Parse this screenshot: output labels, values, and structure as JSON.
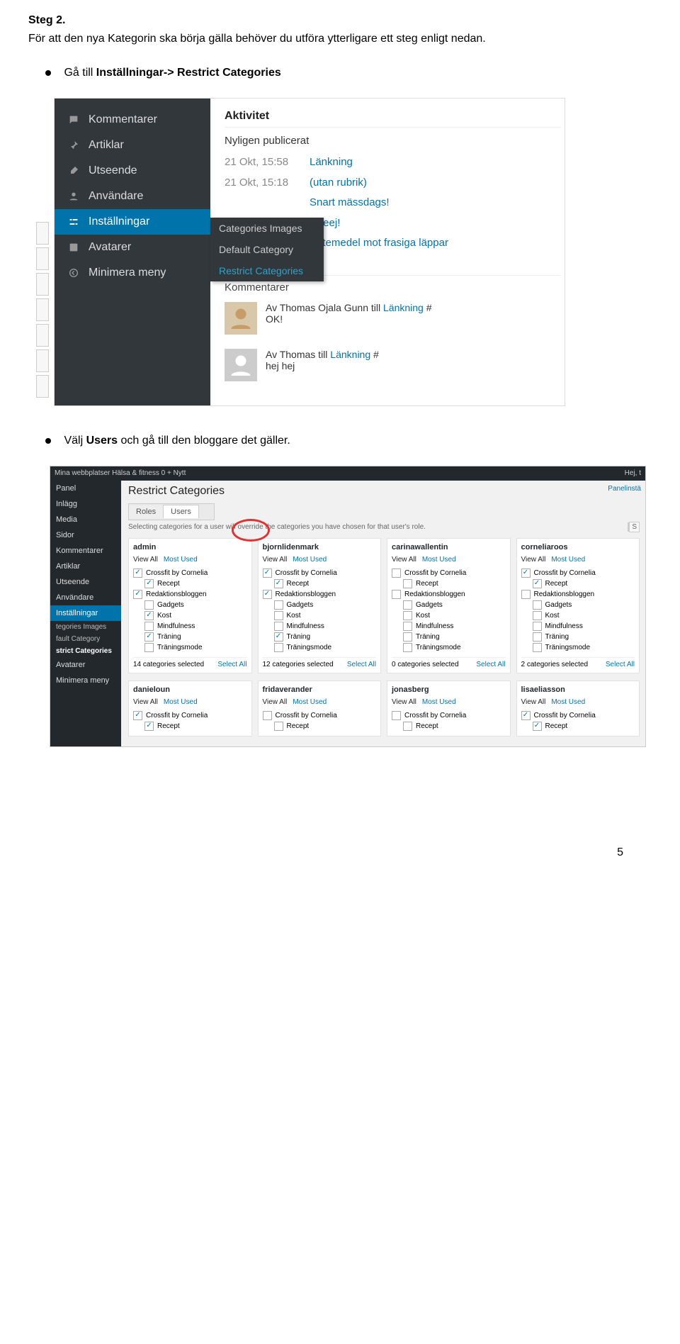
{
  "doc": {
    "step_title": "Steg 2.",
    "intro": "För att den nya Kategorin ska börja gälla behöver du utföra ytterligare ett steg enligt nedan.",
    "bullet1_pre": "Gå till ",
    "bullet1_bold": "Inställningar-> Restrict Categories",
    "bullet2_pre": "Välj ",
    "bullet2_bold": "Users",
    "bullet2_post": " och gå till den bloggare det gäller.",
    "page_number": "5"
  },
  "shot1": {
    "menu": [
      {
        "icon": "comment",
        "label": "Kommentarer"
      },
      {
        "icon": "pin",
        "label": "Artiklar"
      },
      {
        "icon": "brush",
        "label": "Utseende"
      },
      {
        "icon": "user",
        "label": "Användare"
      },
      {
        "icon": "sliders",
        "label": "Inställningar",
        "active": true
      },
      {
        "icon": "avatar",
        "label": "Avatarer"
      },
      {
        "icon": "collapse",
        "label": "Minimera meny"
      }
    ],
    "submenu": [
      {
        "label": "Categories Images"
      },
      {
        "label": "Default Category"
      },
      {
        "label": "Restrict Categories",
        "active": true
      }
    ],
    "panel_title": "Aktivitet",
    "recent_title": "Nyligen publicerat",
    "rows": [
      {
        "c1": "21 Okt, 15:58",
        "c2": "Länkning"
      },
      {
        "c1": "21 Okt, 15:18",
        "c2": "(utan rubrik)"
      },
      {
        "c1": "",
        "c2": "Snart mässdags!"
      },
      {
        "c1": "",
        "c2": "Heeej!"
      },
      {
        "c1": "",
        "c2": "Botemedel mot frasiga läppar"
      }
    ],
    "comments_title": "Kommentarer",
    "c1_text": "Av Thomas Ojala Gunn till ",
    "c1_link": "Länkning",
    "c1_hash": " #",
    "c1_body": "OK!",
    "c2_text": "Av Thomas till ",
    "c2_link": "Länkning",
    "c2_hash": " #",
    "c2_body": "hej hej"
  },
  "shot2": {
    "topbar_left": "Mina webbplatser   Hälsa & fitness   0   + Nytt",
    "topbar_right": "Hej, t",
    "screen_options": "Panelinstä",
    "title": "Restrict Categories",
    "tabs": [
      {
        "label": "Roles"
      },
      {
        "label": "Users",
        "active": true
      }
    ],
    "note": "Selecting categories for a user will override the categories you have chosen for that user's role.",
    "search_btn": "S",
    "side": [
      {
        "label": "Panel"
      },
      {
        "label": "Inlägg"
      },
      {
        "label": "Media"
      },
      {
        "label": "Sidor"
      },
      {
        "label": "Kommentarer"
      },
      {
        "label": "Artiklar"
      },
      {
        "label": "Utseende"
      },
      {
        "label": "Användare"
      },
      {
        "label": "Inställningar",
        "active": true
      }
    ],
    "side_sub": [
      {
        "label": "tegories Images"
      },
      {
        "label": "fault Category"
      },
      {
        "label": "strict Categories",
        "active": true
      }
    ],
    "side_after": [
      {
        "label": "Avatarer"
      },
      {
        "label": "Minimera meny"
      }
    ],
    "filter_all": "View All",
    "filter_most": "Most Used",
    "select_all": "Select All",
    "users": [
      {
        "name": "admin",
        "checks": [
          true,
          true,
          true,
          false,
          true,
          false,
          true,
          false
        ],
        "count": "14 categories selected"
      },
      {
        "name": "bjornlidenmark",
        "checks": [
          true,
          true,
          true,
          false,
          false,
          false,
          true,
          false
        ],
        "count": "12 categories selected"
      },
      {
        "name": "carinawallentin",
        "checks": [
          false,
          false,
          false,
          false,
          false,
          false,
          false,
          false
        ],
        "count": "0 categories selected"
      },
      {
        "name": "corneliaroos",
        "checks": [
          true,
          true,
          false,
          false,
          false,
          false,
          false,
          false
        ],
        "count": "2 categories selected"
      }
    ],
    "cats": [
      "Crossfit by Cornelia",
      "Recept",
      "Redaktionsbloggen",
      "Gadgets",
      "Kost",
      "Mindfulness",
      "Träning",
      "Träningsmode"
    ],
    "indent": [
      false,
      true,
      false,
      true,
      true,
      true,
      true,
      true
    ],
    "users2": [
      {
        "name": "danieloun",
        "checks": [
          true,
          true
        ]
      },
      {
        "name": "fridaverander",
        "checks": [
          false,
          false
        ]
      },
      {
        "name": "jonasberg",
        "checks": [
          false,
          false
        ]
      },
      {
        "name": "lisaeliasson",
        "checks": [
          true,
          true
        ]
      }
    ],
    "cats2": [
      "Crossfit by Cornelia",
      "Recept"
    ],
    "indent2": [
      false,
      true
    ]
  }
}
